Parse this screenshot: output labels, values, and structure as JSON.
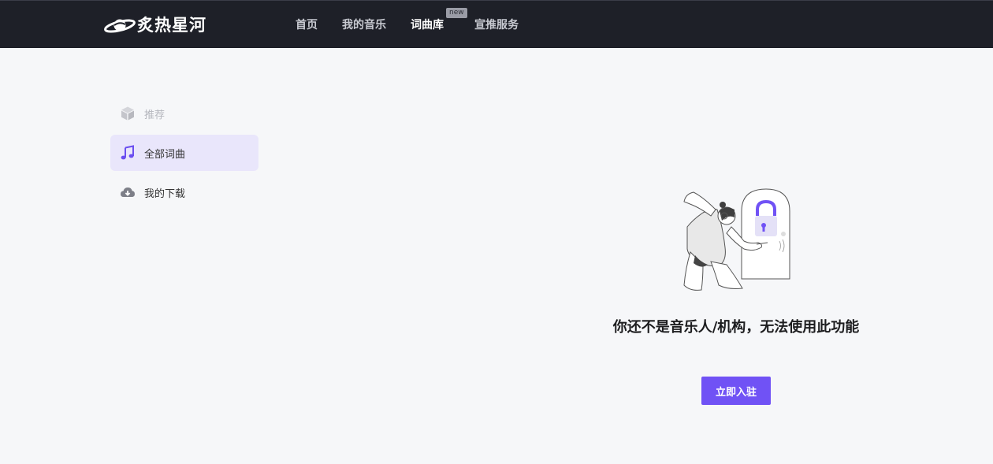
{
  "header": {
    "logo_text": "炙热星河",
    "nav": [
      {
        "label": "首页"
      },
      {
        "label": "我的音乐"
      },
      {
        "label": "词曲库",
        "badge": "new"
      },
      {
        "label": "宣推服务"
      }
    ]
  },
  "sidebar": {
    "items": [
      {
        "label": "推荐",
        "icon": "cube-icon"
      },
      {
        "label": "全部词曲",
        "icon": "music-note-icon"
      },
      {
        "label": "我的下载",
        "icon": "cloud-download-icon"
      }
    ]
  },
  "main": {
    "empty_message": "你还不是音乐人/机构，无法使用此功能",
    "cta_label": "立即入驻"
  },
  "colors": {
    "header_bg": "#1e2028",
    "accent": "#7052f5",
    "active_item_bg": "#e9e6fb",
    "page_bg": "#f6f7f9"
  }
}
